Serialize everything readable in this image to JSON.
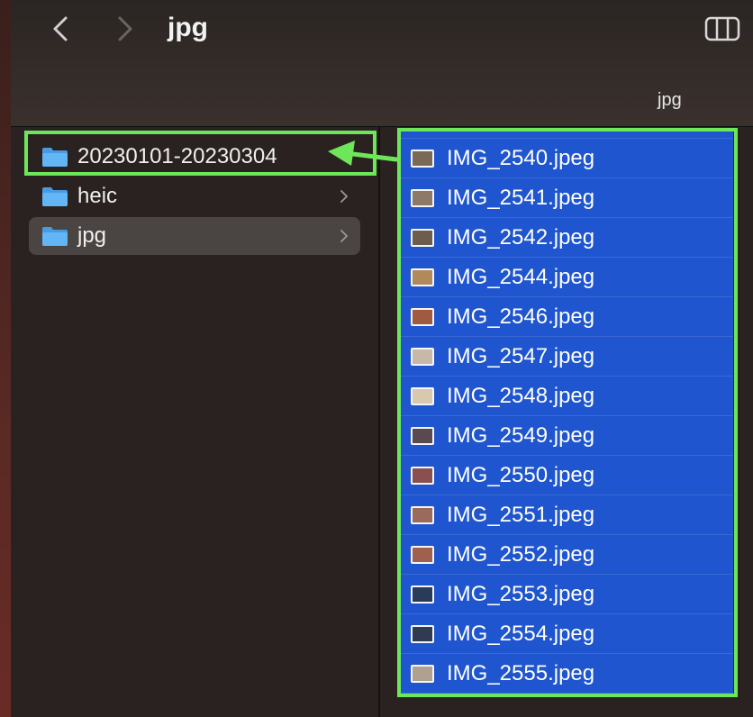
{
  "window": {
    "title": "jpg",
    "column_header": "jpg"
  },
  "sidebar_column": {
    "folders": [
      {
        "label": "20230101-20230304",
        "has_children": false,
        "selected": false,
        "highlighted": true
      },
      {
        "label": "heic",
        "has_children": true,
        "selected": false,
        "highlighted": false
      },
      {
        "label": "jpg",
        "has_children": true,
        "selected": true,
        "highlighted": false
      }
    ]
  },
  "file_column": {
    "files": [
      {
        "name": "IMG_2540.jpeg",
        "thumb_color": "#7a6a55"
      },
      {
        "name": "IMG_2541.jpeg",
        "thumb_color": "#8c7a66"
      },
      {
        "name": "IMG_2542.jpeg",
        "thumb_color": "#6e5d4c"
      },
      {
        "name": "IMG_2544.jpeg",
        "thumb_color": "#b08a5a"
      },
      {
        "name": "IMG_2546.jpeg",
        "thumb_color": "#a05a40"
      },
      {
        "name": "IMG_2547.jpeg",
        "thumb_color": "#c8b8a8"
      },
      {
        "name": "IMG_2548.jpeg",
        "thumb_color": "#d8c8b0"
      },
      {
        "name": "IMG_2549.jpeg",
        "thumb_color": "#5a4a50"
      },
      {
        "name": "IMG_2550.jpeg",
        "thumb_color": "#8a5050"
      },
      {
        "name": "IMG_2551.jpeg",
        "thumb_color": "#9a6a5a"
      },
      {
        "name": "IMG_2552.jpeg",
        "thumb_color": "#a06050"
      },
      {
        "name": "IMG_2553.jpeg",
        "thumb_color": "#2a3a5a"
      },
      {
        "name": "IMG_2554.jpeg",
        "thumb_color": "#303a50"
      },
      {
        "name": "IMG_2555.jpeg",
        "thumb_color": "#b0a090"
      }
    ]
  },
  "colors": {
    "selection_blue": "#1f55cf",
    "highlight_green": "#6ee65a",
    "folder_blue": "#5aaef0"
  }
}
